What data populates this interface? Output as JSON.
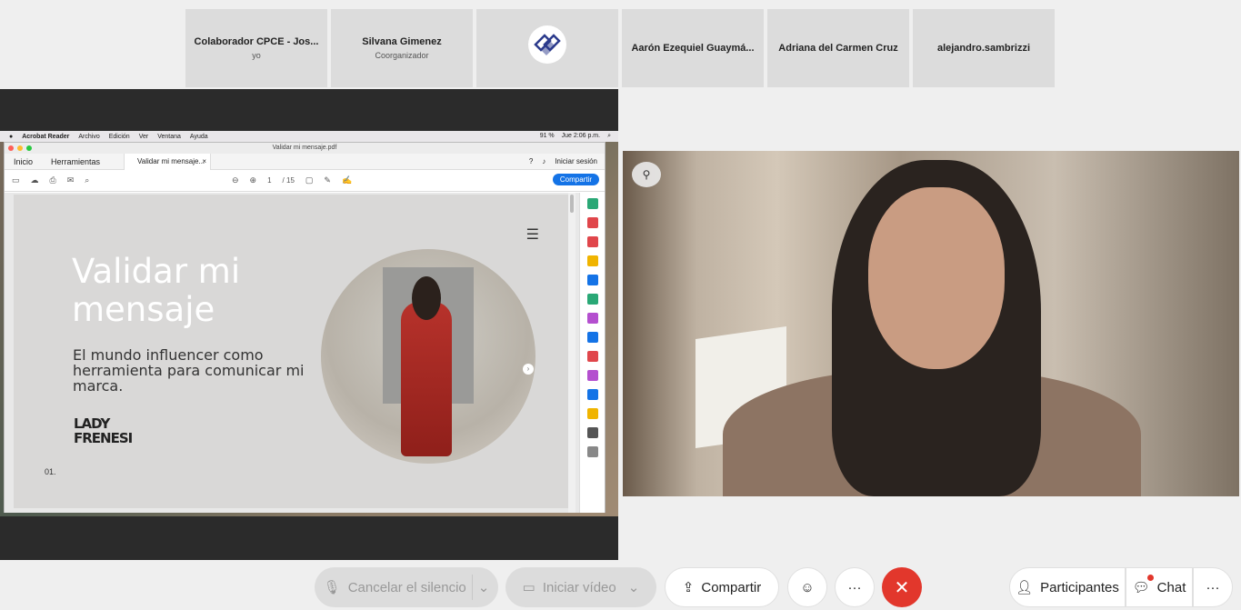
{
  "participants": [
    {
      "name": "Colaborador CPCE - Jos...",
      "role": "yo"
    },
    {
      "name": "Silvana Gimenez",
      "role": "Coorganizador"
    },
    {
      "name": "",
      "role": ""
    },
    {
      "name": "Aarón Ezequiel Guaymá...",
      "role": ""
    },
    {
      "name": "Adriana del Carmen Cruz",
      "role": ""
    },
    {
      "name": "alejandro.sambrizzi",
      "role": ""
    }
  ],
  "mac_menu": {
    "app": "Acrobat Reader",
    "items": [
      "Archivo",
      "Edición",
      "Ver",
      "Ventana",
      "Ayuda"
    ],
    "status": "91 %",
    "clock": "Jue 2:06 p.m."
  },
  "acrobat": {
    "window_title": "Validar mi mensaje.pdf",
    "tab_home": "Inicio",
    "tab_tools": "Herramientas",
    "doc_tab": "Validar mi mensaje...",
    "doc_tab_close": "×",
    "signin": "Iniciar sesión",
    "page_current": "1",
    "page_total": "/ 15",
    "share": "Compartir"
  },
  "slide": {
    "title_line1": "Validar mi",
    "title_line2": "mensaje",
    "subtitle": "El mundo influencer como herramienta para comunicar mi marca.",
    "brand_line1": "LADY",
    "brand_line2": "FRENESI",
    "page_number": "01."
  },
  "controls": {
    "mute": "Cancelar el silencio",
    "video": "Iniciar vídeo",
    "share": "Compartir",
    "participants": "Participantes",
    "chat": "Chat",
    "more": "···"
  },
  "colors": {
    "end_call": "#e2372c",
    "acrobat_blue": "#1473e6"
  }
}
